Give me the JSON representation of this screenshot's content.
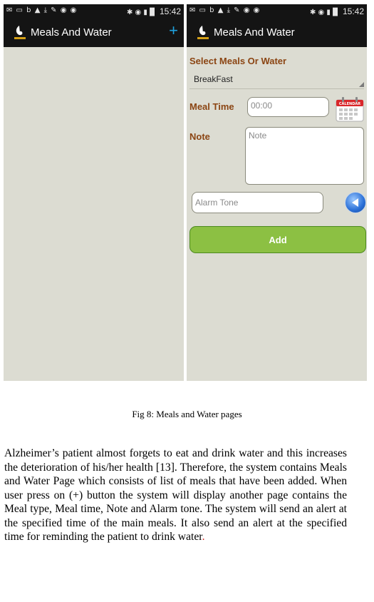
{
  "status_bar": {
    "time": "15:42",
    "left_icons": "✉ ▭ b ▲ ⤓ ✎ ◉ ◉",
    "right_icons": "✱ ◉ ▮ ▉"
  },
  "app": {
    "title": "Meals And Water",
    "add_label": "+"
  },
  "form": {
    "select_header": "Select Meals Or Water",
    "selected_option": "BreakFast",
    "meal_time_label": "Meal Time",
    "meal_time_placeholder": "00:00",
    "note_label": "Note",
    "note_placeholder": "Note",
    "alarm_placeholder": "Alarm Tone",
    "add_label": "Add",
    "calendar_text": "CALENDAR"
  },
  "caption": "Fig 8: Meals and Water pages",
  "paragraph": {
    "text": "Alzheimer’s patient almost forgets to eat and drink water and this increases the deterioration of his/her health [13]. Therefore, the system contains Meals and Water Page which consists of list of meals that have been added. When user press on (+) button the system will display another page contains the Meal type, Meal time, Note and Alarm tone. The system will send an alert at the specified time of the main meals. It also send an alert at the specified time for reminding the patient to drink water",
    "end_mark": "."
  },
  "colors": {
    "accent": "#1fa3e0",
    "label": "#8b4513",
    "add_button": "#8cc043",
    "background": "#dcdcd2"
  }
}
